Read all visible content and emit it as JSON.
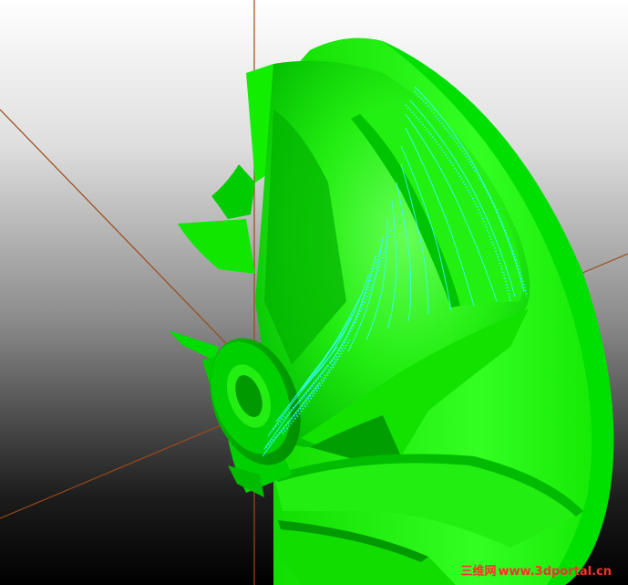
{
  "viewport": {
    "background_top": "#ffffff",
    "background_bottom": "#000000",
    "model_color": "#00dd00",
    "model_highlight": "#44ff33",
    "model_shadow": "#00a000",
    "toolpath_color": "#33ffff",
    "axis_color": "#9a4a1a"
  },
  "watermark": {
    "chinese": "三维网",
    "url": "www.3dportal.cn",
    "color": "#ff2e2e"
  }
}
